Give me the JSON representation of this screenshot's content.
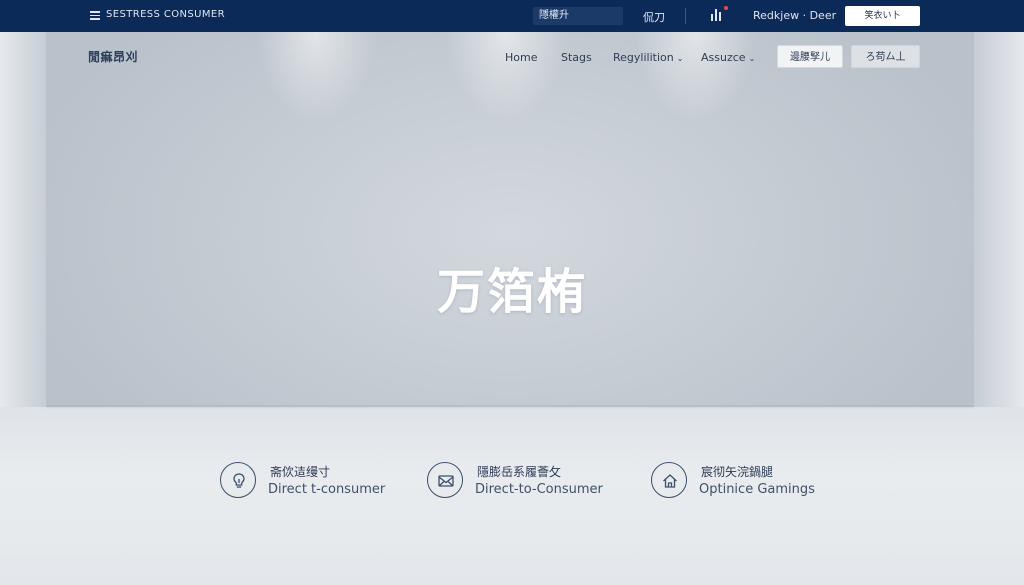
{
  "topbar": {
    "brand": "SESTRESS CONSUMER",
    "search_text": "隱權升",
    "language": "侃刀",
    "user": "Redkjew · Deer",
    "cta_label": "笑衣い卜"
  },
  "nav": {
    "logo": "閒痲昂刈",
    "items": [
      {
        "label": "Home"
      },
      {
        "label": "Stags"
      },
      {
        "label": "Regylilition"
      },
      {
        "label": "Assuzce"
      }
    ],
    "secondary_button": "邊腰孯儿",
    "primary_button": "ろ苟厶丄"
  },
  "hero": {
    "title": "万箔栯"
  },
  "features": [
    {
      "icon": "lightbulb-icon",
      "label_cn": "斋佽迼缦寸",
      "label_en": "Direct t-consumer"
    },
    {
      "icon": "mail-icon",
      "label_cn": "隱膨岳系履薈攵",
      "label_en": "Direct-to-Consumer"
    },
    {
      "icon": "home-icon",
      "label_cn": "宸彻矢浣鍋腿",
      "label_en": "Optinice Gamings"
    }
  ],
  "colors": {
    "topbar_bg": "#0c2a57",
    "accent_text": "#2e3e56",
    "notification_dot": "#e84a4a"
  }
}
